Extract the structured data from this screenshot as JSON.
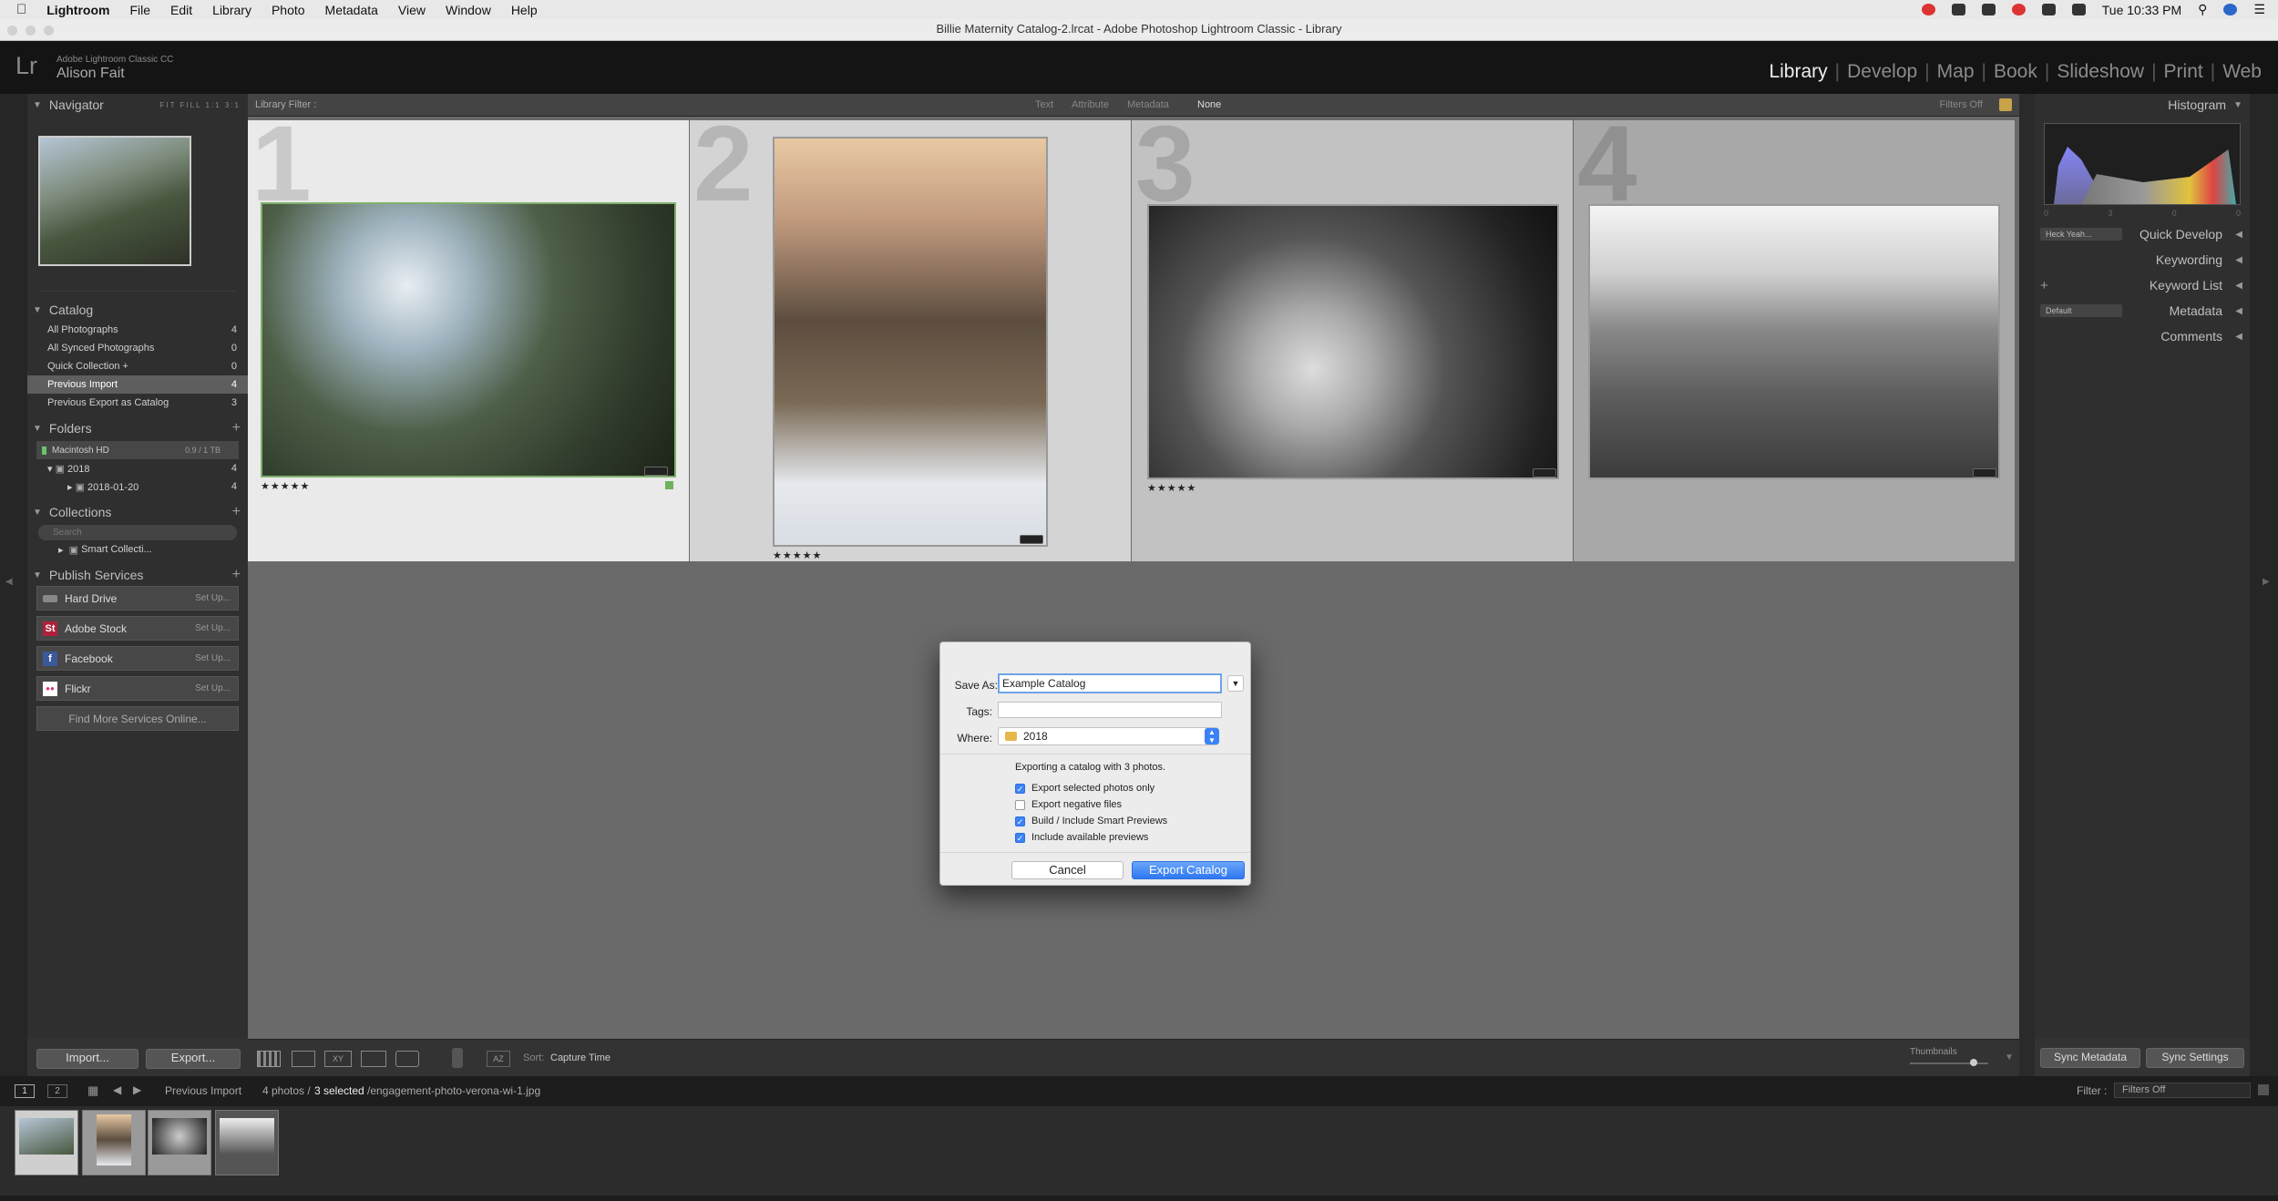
{
  "menubar": {
    "app": "Lightroom",
    "items": [
      "File",
      "Edit",
      "Library",
      "Photo",
      "Metadata",
      "View",
      "Window",
      "Help"
    ],
    "clock": "Tue 10:33 PM"
  },
  "window_title": "Billie Maternity Catalog-2.lrcat - Adobe Photoshop Lightroom Classic - Library",
  "identity": {
    "logo": "Lr",
    "product": "Adobe Lightroom Classic CC",
    "user": "Alison Fait"
  },
  "modules": [
    "Library",
    "Develop",
    "Map",
    "Book",
    "Slideshow",
    "Print",
    "Web"
  ],
  "active_module": "Library",
  "left": {
    "navigator": {
      "title": "Navigator",
      "zooms": [
        "FIT",
        "FILL",
        "1:1",
        "3:1"
      ]
    },
    "catalog": {
      "title": "Catalog",
      "items": [
        {
          "label": "All Photographs",
          "count": "4"
        },
        {
          "label": "All Synced Photographs",
          "count": "0"
        },
        {
          "label": "Quick Collection +",
          "count": "0"
        },
        {
          "label": "Previous Import",
          "count": "4"
        },
        {
          "label": "Previous Export as Catalog",
          "count": "3"
        }
      ]
    },
    "folders": {
      "title": "Folders",
      "volume": "Macintosh HD",
      "volume_info": "0.9 / 1 TB",
      "items": [
        {
          "label": "2018",
          "count": "4"
        },
        {
          "label": "2018-01-20",
          "count": "4"
        }
      ]
    },
    "collections": {
      "title": "Collections",
      "search_placeholder": "Search",
      "item": "Smart Collecti..."
    },
    "publish": {
      "title": "Publish Services",
      "services": [
        {
          "label": "Hard Drive",
          "action": "Set Up...",
          "color": "#888888",
          "glyph": ""
        },
        {
          "label": "Adobe Stock",
          "action": "Set Up...",
          "color": "#b0203a",
          "glyph": "St"
        },
        {
          "label": "Facebook",
          "action": "Set Up...",
          "color": "#3b5998",
          "glyph": "f"
        },
        {
          "label": "Flickr",
          "action": "Set Up...",
          "color": "#ffffff",
          "glyph": "●●"
        }
      ],
      "find_more": "Find More Services Online..."
    },
    "import_btn": "Import...",
    "export_btn": "Export..."
  },
  "filter_bar": {
    "label": "Library Filter :",
    "options": [
      "Text",
      "Attribute",
      "Metadata",
      "None"
    ],
    "filters_off": "Filters Off"
  },
  "grid": [
    {
      "index": "1",
      "stars": "★★★★★",
      "selected": true
    },
    {
      "index": "2",
      "stars": "★★★★★",
      "selected": true
    },
    {
      "index": "3",
      "stars": "★★★★★",
      "selected": true
    },
    {
      "index": "4",
      "stars": "",
      "selected": false
    }
  ],
  "dialog": {
    "save_as_label": "Save As:",
    "save_as_value": "Example Catalog",
    "tags_label": "Tags:",
    "tags_value": "",
    "where_label": "Where:",
    "where_value": "2018",
    "info": "Exporting a catalog with 3 photos.",
    "options": [
      {
        "label": "Export selected photos only",
        "checked": true
      },
      {
        "label": "Export negative files",
        "checked": false
      },
      {
        "label": "Build / Include Smart Previews",
        "checked": true
      },
      {
        "label": "Include available previews",
        "checked": true
      }
    ],
    "cancel": "Cancel",
    "confirm": "Export Catalog"
  },
  "toolbar": {
    "sort_label": "Sort:",
    "sort_value": "Capture Time",
    "thumbnails_label": "Thumbnails"
  },
  "right": {
    "histogram": "Histogram",
    "histo_info": [
      "0",
      "3",
      "0",
      "0"
    ],
    "preset_value": "Heck Yeah...",
    "quick_develop": "Quick Develop",
    "keywording": "Keywording",
    "keyword_list": "Keyword List",
    "metadata_preset": "Default",
    "metadata": "Metadata",
    "comments": "Comments",
    "sync_metadata": "Sync Metadata",
    "sync_settings": "Sync Settings"
  },
  "filmstrip": {
    "pages": [
      "1",
      "2"
    ],
    "source": "Previous Import",
    "count_text": "4 photos /",
    "selected_text": "3 selected",
    "path": "/engagement-photo-verona-wi-1.jpg",
    "filter_label": "Filter :",
    "filter_value": "Filters Off"
  }
}
